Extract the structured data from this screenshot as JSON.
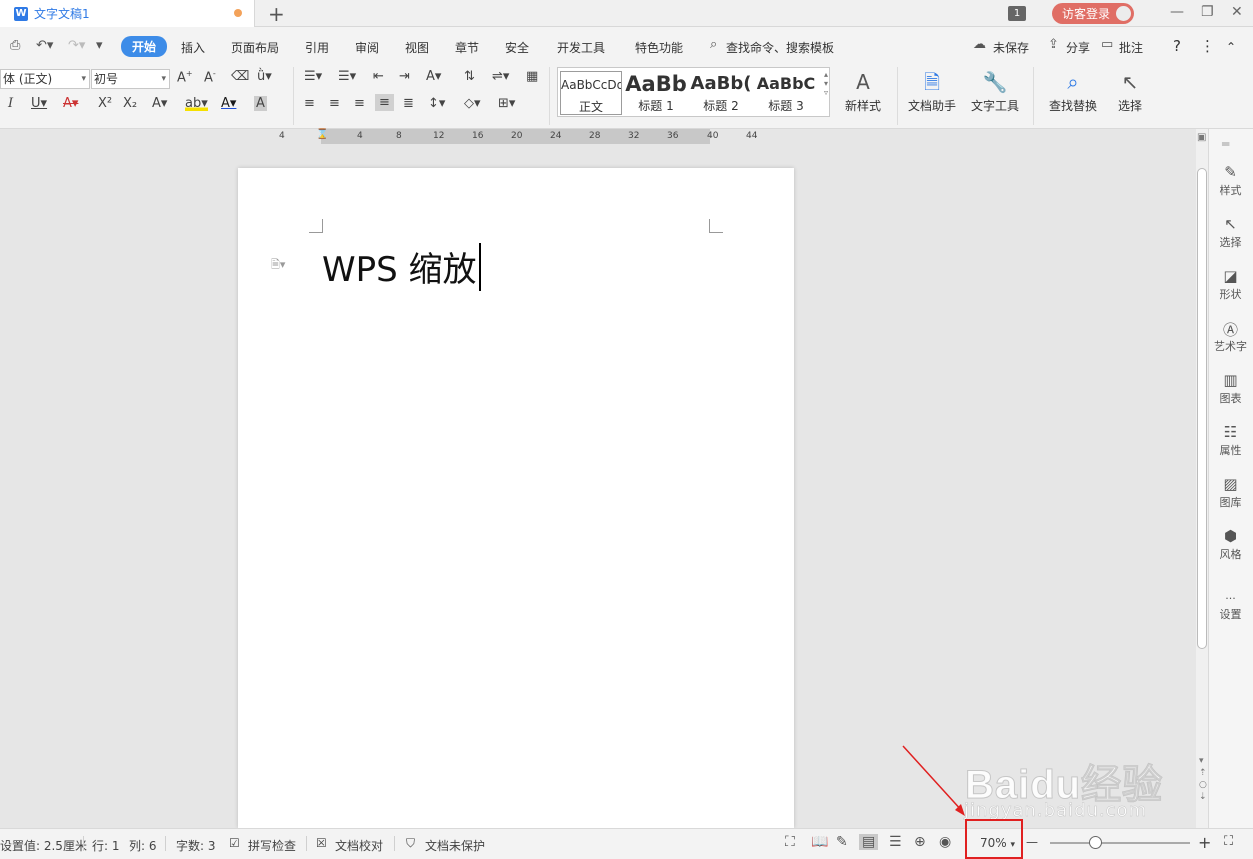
{
  "titlebar": {
    "doc_name": "文字文稿1",
    "app_icon": "W",
    "new_tab": "+",
    "page_count": "1",
    "login": "访客登录",
    "min": "—",
    "max": "❐",
    "close": "✕"
  },
  "menu": {
    "items": [
      "开始",
      "插入",
      "页面布局",
      "引用",
      "审阅",
      "视图",
      "章节",
      "安全",
      "开发工具",
      "特色功能"
    ],
    "search": "查找命令、搜索模板",
    "unsaved": "未保存",
    "share": "分享",
    "comment": "批注",
    "help": "?",
    "more": "⋮",
    "collapse": "⌃"
  },
  "ribbon": {
    "font_name": "体 (正文)",
    "font_size": "初号",
    "styles": [
      {
        "preview": "AaBbCcDd",
        "label": "正文"
      },
      {
        "preview": "AaBb",
        "label": "标题 1"
      },
      {
        "preview": "AaBb(",
        "label": "标题 2"
      },
      {
        "preview": "AaBbC",
        "label": "标题 3"
      }
    ],
    "new_style": "新样式",
    "doc_assistant": "文档助手",
    "text_tools": "文字工具",
    "find_replace": "查找替换",
    "select": "选择"
  },
  "ruler": {
    "ticks": [
      "4",
      "4",
      "8",
      "12",
      "16",
      "20",
      "24",
      "28",
      "32",
      "36",
      "40",
      "44"
    ]
  },
  "document": {
    "text": "WPS 缩放"
  },
  "sidebar": {
    "items": [
      "样式",
      "选择",
      "形状",
      "艺术字",
      "图表",
      "属性",
      "图库",
      "风格",
      "设置"
    ]
  },
  "status": {
    "setting_value": "设置值: 2.5厘米",
    "row": "行: 1",
    "col": "列: 6",
    "word_count": "字数: 3",
    "spell_check": "拼写检查",
    "doc_proof": "文档校对",
    "doc_unprotected": "文档未保护",
    "zoom": "70%",
    "zoom_value": 0.7,
    "zoom_minus": "—",
    "zoom_plus": "+"
  },
  "watermark": {
    "logo": "Baidu经验",
    "url": "jingyan.baidu.com"
  }
}
